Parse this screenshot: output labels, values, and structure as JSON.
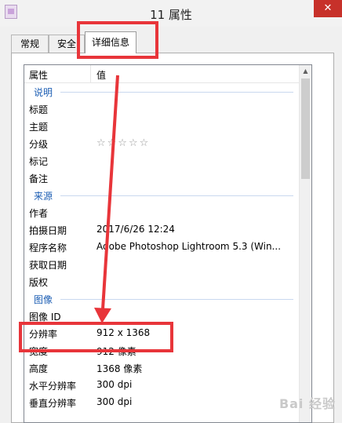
{
  "window": {
    "title": "11 属性",
    "close_glyph": "✕"
  },
  "tabs": [
    "常规",
    "安全",
    "详细信息"
  ],
  "list": {
    "header": {
      "name": "属性",
      "value": "值"
    },
    "rows": [
      {
        "type": "section",
        "name": "说明"
      },
      {
        "type": "row",
        "name": "标题",
        "value": ""
      },
      {
        "type": "row",
        "name": "主题",
        "value": ""
      },
      {
        "type": "row",
        "name": "分级",
        "value": "☆☆☆☆☆"
      },
      {
        "type": "row",
        "name": "标记",
        "value": ""
      },
      {
        "type": "row",
        "name": "备注",
        "value": ""
      },
      {
        "type": "section",
        "name": "来源"
      },
      {
        "type": "row",
        "name": "作者",
        "value": ""
      },
      {
        "type": "row",
        "name": "拍摄日期",
        "value": "2017/6/26 12:24"
      },
      {
        "type": "row",
        "name": "程序名称",
        "value": "Adobe Photoshop Lightroom 5.3 (Win..."
      },
      {
        "type": "row",
        "name": "获取日期",
        "value": ""
      },
      {
        "type": "row",
        "name": "版权",
        "value": ""
      },
      {
        "type": "section",
        "name": "图像"
      },
      {
        "type": "row",
        "name": "图像 ID",
        "value": ""
      },
      {
        "type": "row",
        "name": "分辨率",
        "value": "912 x 1368"
      },
      {
        "type": "row",
        "name": "宽度",
        "value": "912 像素"
      },
      {
        "type": "row",
        "name": "高度",
        "value": "1368 像素"
      },
      {
        "type": "row",
        "name": "水平分辨率",
        "value": "300 dpi"
      },
      {
        "type": "row",
        "name": "垂直分辨率",
        "value": "300 dpi"
      }
    ]
  },
  "watermark": "Bai 经验",
  "colors": {
    "annotation": "#e8353a",
    "section_title": "#1e5fb4"
  }
}
